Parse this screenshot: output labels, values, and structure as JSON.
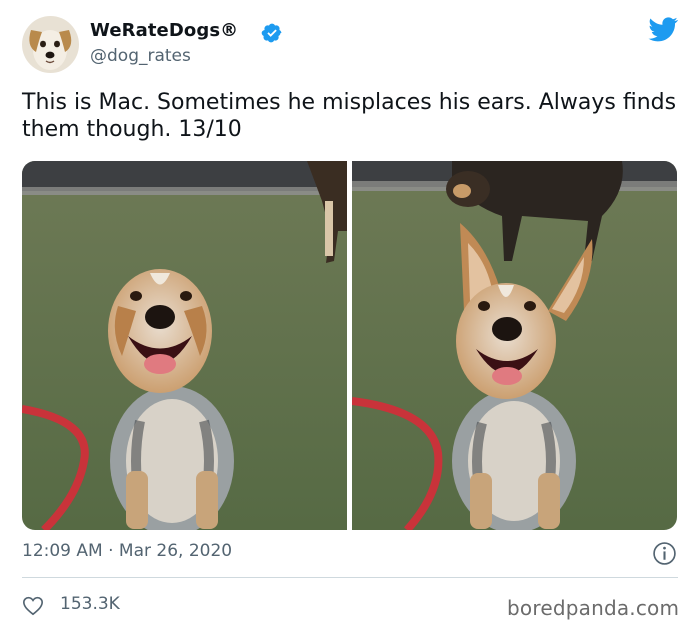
{
  "author": {
    "display_name": "WeRateDogs",
    "registered_mark": "®",
    "handle": "@dog_rates",
    "avatar_icon": "dog-face-avatar",
    "verified_icon": "verified-badge-icon"
  },
  "brand": {
    "logo_icon": "twitter-bird-icon",
    "accent_color": "#1d9bf0"
  },
  "tweet": {
    "text": "This is Mac. Sometimes he misplaces his ears. Always finds them though. 13/10",
    "time": "12:09 AM",
    "separator": "·",
    "date": "Mar 26, 2020",
    "likes": "153.3K"
  },
  "media": {
    "photos": [
      {
        "name": "mac-ears-down-photo"
      },
      {
        "name": "mac-ears-up-photo"
      }
    ]
  },
  "footer": {
    "info_icon": "info-icon",
    "like_icon": "heart-outline-icon",
    "watermark": "boredpanda.com"
  },
  "colors": {
    "text_primary": "#0f1419",
    "text_secondary": "#536471",
    "divider": "#cfd9de"
  }
}
